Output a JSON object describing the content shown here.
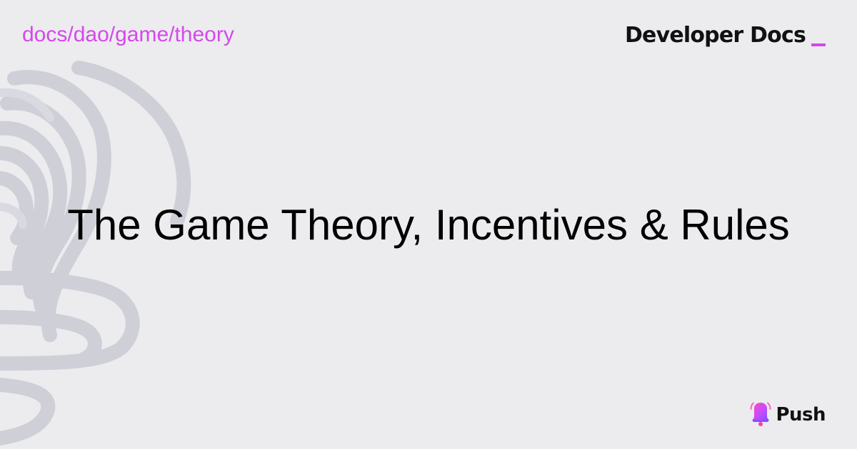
{
  "breadcrumb": "docs/dao/game/theory",
  "brand": {
    "title": "Developer Docs"
  },
  "title": "The Game Theory, Incentives & Rules",
  "logo": {
    "text": "Push"
  },
  "colors": {
    "background": "#ececef",
    "accent": "#d548ec",
    "text": "#000000",
    "decorative_outline": "#cfcfd8"
  },
  "icons": {
    "background_art": "bell-outline-illustration",
    "logo_icon": "push-bell-icon"
  }
}
